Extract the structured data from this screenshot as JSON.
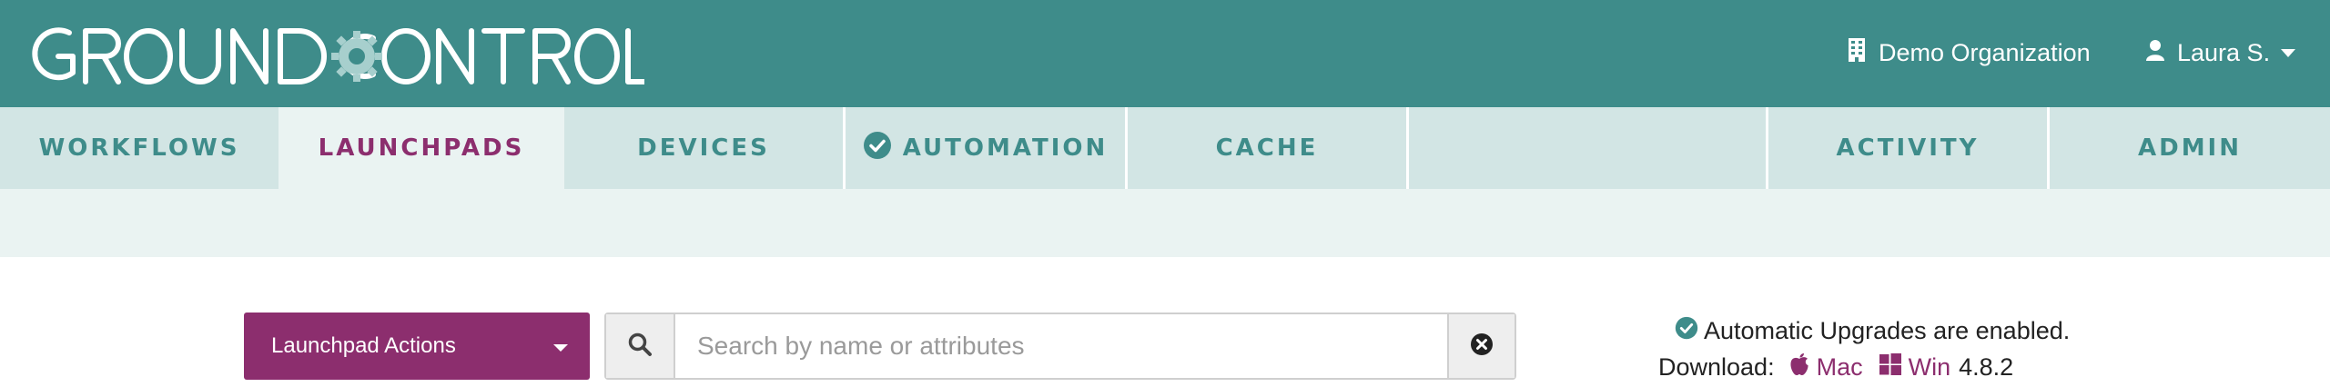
{
  "header": {
    "logo_text": "GROUNDCONTROL",
    "organization": "Demo Organization",
    "user": "Laura S."
  },
  "nav": {
    "tabs": [
      {
        "label": "WORKFLOWS"
      },
      {
        "label": "LAUNCHPADS"
      },
      {
        "label": "DEVICES"
      },
      {
        "label": "AUTOMATION"
      },
      {
        "label": "CACHE"
      },
      {
        "label": "ACTIVITY"
      },
      {
        "label": "ADMIN"
      }
    ],
    "active_tab": "LAUNCHPADS"
  },
  "toolbar": {
    "actions_label": "Launchpad Actions",
    "search_placeholder": "Search by name or attributes",
    "search_value": ""
  },
  "status": {
    "upgrades_text": "Automatic Upgrades are enabled.",
    "download_label": "Download:",
    "mac_label": "Mac",
    "win_label": "Win",
    "version": "4.8.2"
  },
  "colors": {
    "header": "#3e8c8a",
    "nav": "#d2e5e4",
    "nav_text": "#3e8c8a",
    "accent": "#8c2e6e"
  },
  "icons": [
    "building-icon",
    "user-icon",
    "check-circle-icon",
    "search-icon",
    "clear-icon",
    "apple-icon",
    "windows-icon",
    "gear-icon"
  ]
}
